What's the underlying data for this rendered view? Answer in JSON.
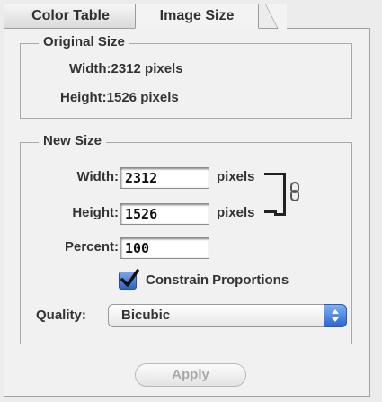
{
  "tabs": [
    {
      "label": "Color Table",
      "active": false
    },
    {
      "label": "Image Size",
      "active": true
    }
  ],
  "original_size": {
    "legend": "Original Size",
    "width_text": "Width:2312 pixels",
    "height_text": "Height:1526 pixels"
  },
  "new_size": {
    "legend": "New Size",
    "width_label": "Width:",
    "width_value": "2312",
    "width_unit": "pixels",
    "height_label": "Height:",
    "height_value": "1526",
    "height_unit": "pixels",
    "percent_label": "Percent:",
    "percent_value": "100",
    "constrain_label": "Constrain Proportions",
    "constrain_checked": true,
    "quality_label": "Quality:",
    "quality_value": "Bicubic"
  },
  "apply_label": "Apply",
  "colors": {
    "accent": "#3a73d6",
    "panel_bg": "#f1f1f1",
    "disabled_text": "#a9a9a9"
  },
  "icons": {
    "link": "chain-link-icon",
    "checkbox": "checkmark-icon",
    "select_arrows": "up-down-arrows-icon"
  }
}
